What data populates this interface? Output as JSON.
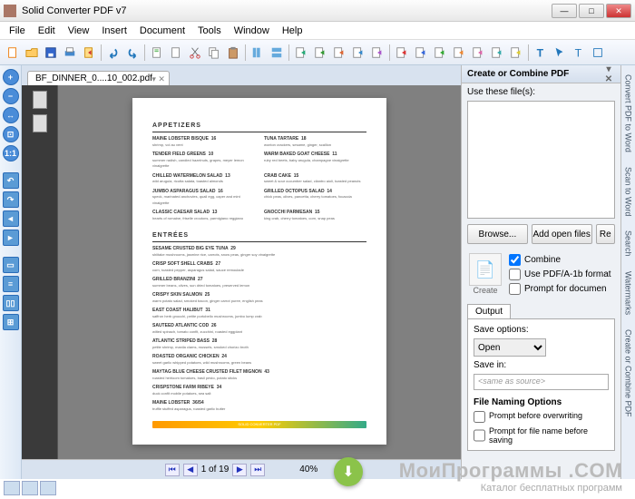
{
  "window": {
    "title": "Solid Converter PDF v7"
  },
  "menu": [
    "File",
    "Edit",
    "View",
    "Insert",
    "Document",
    "Tools",
    "Window",
    "Help"
  ],
  "tab": {
    "label": "BF_DINNER_0....10_002.pdf"
  },
  "pagenav": {
    "label": "1 of 19",
    "zoom": "40%"
  },
  "doc": {
    "section1": "APPETIZERS",
    "appetizers_left": [
      {
        "n": "MAINE LOBSTER BISQUE",
        "p": "16",
        "d": "shrimp, vol au vent"
      },
      {
        "n": "TENDER FIELD GREENS",
        "p": "10",
        "d": "summer radish, candied hazelnuts, grapes, meyer lemon vinaigrette"
      },
      {
        "n": "CHILLED WATERMELON SALAD",
        "p": "13",
        "d": "wild arugula, ricotta salata, toasted almonds"
      },
      {
        "n": "JUMBO ASPARAGUS SALAD",
        "p": "16",
        "d": "speck, marinated anchovies, quail egg, caper and mint vinaigrette"
      },
      {
        "n": "CLASSIC CAESAR SALAD",
        "p": "13",
        "d": "hearts of romaine, friselle croutons, parmigiano reggiano"
      }
    ],
    "appetizers_right": [
      {
        "n": "TUNA TARTARE",
        "p": "18",
        "d": "wonton crackers, sesame, ginger, scallion"
      },
      {
        "n": "WARM BAKED GOAT CHEESE",
        "p": "11",
        "d": "ruby red beets, baby arugula, champagne vinaigrette"
      },
      {
        "n": "CRAB CAKE",
        "p": "15",
        "d": "sweet & sour cucumber salad, cilantro aioli, toasted peanuts"
      },
      {
        "n": "GRILLED OCTOPUS SALAD",
        "p": "14",
        "d": "chick peas, olives, pancetta, cherry tomatoes, focaccia"
      },
      {
        "n": "GNOCCHI PARMESAN",
        "p": "15",
        "d": "king crab, cherry tomatoes, corn, snap peas"
      }
    ],
    "section2": "ENTRÉES",
    "entrees": [
      {
        "n": "SESAME CRUSTED BIG EYE TUNA",
        "p": "29",
        "d": "shiitake mushrooms, jasmine rice, carrots, snow peas, ginger soy vinaigrette"
      },
      {
        "n": "CRISP SOFT SHELL CRABS",
        "p": "27",
        "d": "corn, toasted pepper, asparagus salad, sauce remoulade"
      },
      {
        "n": "GRILLED BRANZINI",
        "p": "27",
        "d": "summer beans, olives, sun dried tomatoes, preserved lemon"
      },
      {
        "n": "CRISPY SKIN SALMON",
        "p": "25",
        "d": "warm potato salad, smoked bacon, ginger carrot puree, english peas"
      },
      {
        "n": "EAST COAST HALIBUT",
        "p": "31",
        "d": "saffron herb gnocchi, petite portobello mushrooms, jumbo lump crab"
      },
      {
        "n": "SAUTEED ATLANTIC COD",
        "p": "26",
        "d": "wilted spinach, tomato confit, zucchini, roasted eggplant"
      },
      {
        "n": "ATLANTIC STRIPED BASS",
        "p": "28",
        "d": "petite shrimp, manila clams, mussels, smoked chorizo broth"
      },
      {
        "n": "ROASTED ORGANIC CHICKEN",
        "p": "24",
        "d": "sweet garlic whipped potatoes, wild mushrooms, green beans"
      },
      {
        "n": "MAYTAG BLUE CHEESE CRUSTED FILET MIGNON",
        "p": "43",
        "d": "roasted heirloom tomatoes, basil pesto, potato sticks"
      },
      {
        "n": "CRISPSTONE FARM RIBEYE",
        "p": "34",
        "d": "duck confit mobile potatoes, sea salt"
      },
      {
        "n": "MAINE LOBSTER",
        "p": "36/54",
        "d": "truffle stuffed asparagus, roasted garlic butter"
      }
    ],
    "footer": "SOLID CONVERTER PDF"
  },
  "rightpanel": {
    "title": "Create or Combine PDF",
    "filelabel": "Use these file(s):",
    "browse": "Browse...",
    "addopen": "Add open files",
    "remove": "Re",
    "create": "Create",
    "chk_combine": "Combine",
    "chk_pdfa": "Use PDF/A-1b format",
    "chk_prompt": "Prompt for documen",
    "output": "Output",
    "saveopt": "Save options:",
    "saveopt_val": "Open",
    "savein": "Save in:",
    "savein_ph": "<same as source>",
    "fno": "File Naming Options",
    "chk_over": "Prompt before overwriting",
    "chk_name": "Prompt for file name before saving"
  },
  "sidetabs": [
    "Convert PDF to Word",
    "Scan to Word",
    "Search",
    "Watermarks",
    "Create or Combine PDF"
  ],
  "watermark": {
    "l1": "МоиПрограммы .COM",
    "l2": "Каталог бесплатных программ"
  }
}
